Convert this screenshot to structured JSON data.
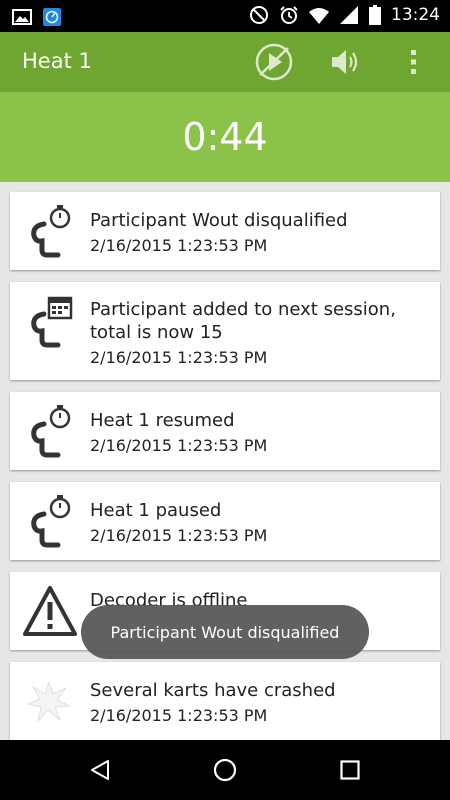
{
  "status_bar": {
    "time": "13:24",
    "icons": [
      "image-icon",
      "app-notification-icon",
      "do-not-disturb-icon",
      "alarm-icon",
      "wifi-icon",
      "signal-icon",
      "battery-icon"
    ]
  },
  "app_bar": {
    "title": "Heat 1",
    "actions": [
      "replay-off-icon",
      "volume-icon",
      "overflow-menu-icon"
    ]
  },
  "timer": {
    "value": "0:44"
  },
  "events": [
    {
      "icon": "race-stopwatch-icon",
      "message": "Participant Wout disqualified",
      "time": "2/16/2015 1:23:53 PM"
    },
    {
      "icon": "race-calendar-icon",
      "message": "Participant added to next session, total is now 15",
      "time": "2/16/2015 1:23:53 PM"
    },
    {
      "icon": "race-stopwatch-icon",
      "message": "Heat 1 resumed",
      "time": "2/16/2015 1:23:53 PM"
    },
    {
      "icon": "race-stopwatch-icon",
      "message": "Heat 1 paused",
      "time": "2/16/2015 1:23:53 PM"
    },
    {
      "icon": "warning-icon",
      "message": "Decoder is offline",
      "time": ""
    },
    {
      "icon": "crash-icon",
      "message": "Several karts have crashed",
      "time": "2/16/2015 1:23:53 PM"
    }
  ],
  "toast": {
    "text": "Participant Wout disqualified"
  },
  "nav_bar": {
    "buttons": [
      "back-icon",
      "home-icon",
      "recents-icon"
    ]
  },
  "colors": {
    "app_bar": "#6fa632",
    "timer_bar": "#8bc34a",
    "background": "#e6e6e6"
  }
}
